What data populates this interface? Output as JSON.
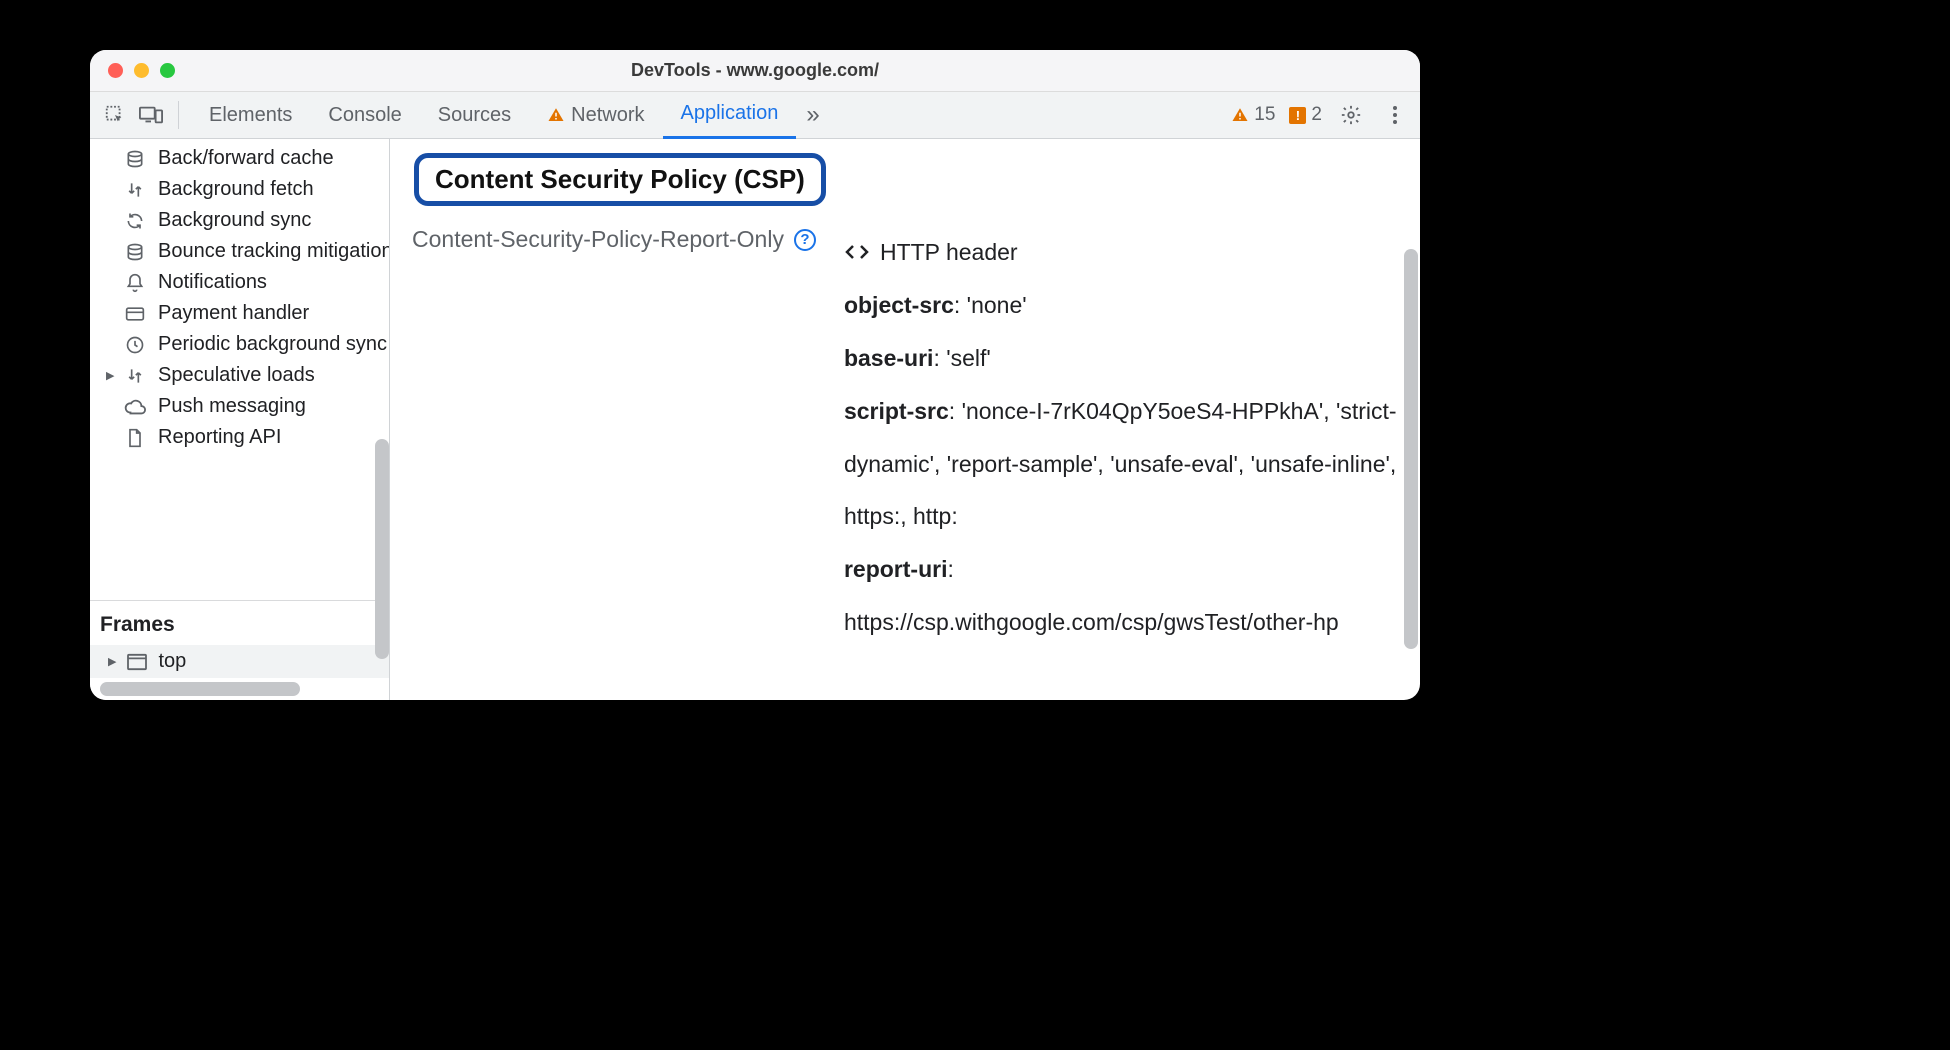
{
  "window": {
    "title": "DevTools - www.google.com/"
  },
  "toolbar": {
    "tabs": [
      {
        "label": "Elements",
        "active": false,
        "warn": false
      },
      {
        "label": "Console",
        "active": false,
        "warn": false
      },
      {
        "label": "Sources",
        "active": false,
        "warn": false
      },
      {
        "label": "Network",
        "active": false,
        "warn": true
      },
      {
        "label": "Application",
        "active": true,
        "warn": false
      }
    ],
    "overflow": "»",
    "warnings_count": "15",
    "issues_count": "2"
  },
  "sidebar": {
    "items": [
      {
        "icon": "database",
        "label": "Back/forward cache",
        "expandable": false
      },
      {
        "icon": "updown",
        "label": "Background fetch",
        "expandable": false
      },
      {
        "icon": "sync",
        "label": "Background sync",
        "expandable": false
      },
      {
        "icon": "database",
        "label": "Bounce tracking mitigations",
        "expandable": false
      },
      {
        "icon": "bell",
        "label": "Notifications",
        "expandable": false
      },
      {
        "icon": "card",
        "label": "Payment handler",
        "expandable": false
      },
      {
        "icon": "clock",
        "label": "Periodic background sync",
        "expandable": false
      },
      {
        "icon": "updown",
        "label": "Speculative loads",
        "expandable": true
      },
      {
        "icon": "cloud",
        "label": "Push messaging",
        "expandable": false
      },
      {
        "icon": "file",
        "label": "Reporting API",
        "expandable": false
      }
    ],
    "frames_header": "Frames",
    "frames_top": "top"
  },
  "main": {
    "csp_title": "Content Security Policy (CSP)",
    "policy_name": "Content-Security-Policy-Report-Only",
    "delivered_via": "HTTP header",
    "directives": [
      {
        "name": "object-src",
        "value": "'none'"
      },
      {
        "name": "base-uri",
        "value": "'self'"
      },
      {
        "name": "script-src",
        "value": "'nonce-I-7rK04QpY5oeS4-HPPkhA', 'strict-dynamic', 'report-sample', 'unsafe-eval', 'unsafe-inline', https:, http:"
      },
      {
        "name": "report-uri",
        "value": "https://csp.withgoogle.com/csp/gwsTest/other-hp"
      }
    ]
  }
}
